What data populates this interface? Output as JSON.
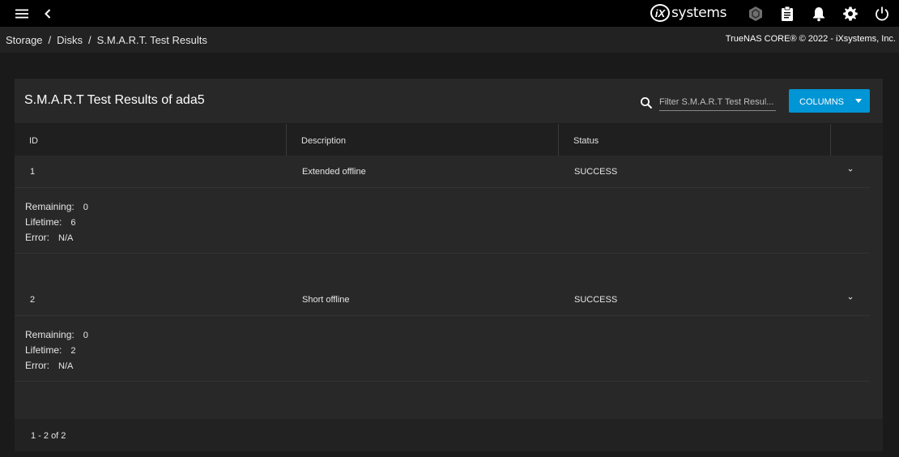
{
  "topbar": {
    "logo_mark": "iX",
    "logo_text": "systems"
  },
  "breadcrumb": {
    "items": [
      "Storage",
      "Disks",
      "S.M.A.R.T. Test Results"
    ],
    "separator": "/"
  },
  "copyright": "TrueNAS CORE® © 2022 - iXsystems, Inc.",
  "card": {
    "title": "S.M.A.R.T Test Results of ada5",
    "filter_placeholder": "Filter S.M.A.R.T Test Resul...",
    "columns_label": "COLUMNS"
  },
  "table": {
    "headers": {
      "id": "ID",
      "description": "Description",
      "status": "Status"
    },
    "rows": [
      {
        "id": "1",
        "description": "Extended offline",
        "status": "SUCCESS",
        "details": {
          "remaining_label": "Remaining:",
          "remaining": "0",
          "lifetime_label": "Lifetime:",
          "lifetime": "6",
          "error_label": "Error:",
          "error": "N/A"
        }
      },
      {
        "id": "2",
        "description": "Short offline",
        "status": "SUCCESS",
        "details": {
          "remaining_label": "Remaining:",
          "remaining": "0",
          "lifetime_label": "Lifetime:",
          "lifetime": "2",
          "error_label": "Error:",
          "error": "N/A"
        }
      }
    ]
  },
  "pagination": {
    "range": "1 - 2 of 2"
  },
  "colors": {
    "topbar": "#000000",
    "background": "#1a1a1a",
    "card": "#282828",
    "accent": "#0095d5"
  },
  "icons": [
    "menu-icon",
    "chevron-left-icon",
    "truecommand-icon",
    "clipboard-icon",
    "bell-icon",
    "gear-icon",
    "power-icon",
    "search-icon",
    "chevron-down-icon"
  ]
}
